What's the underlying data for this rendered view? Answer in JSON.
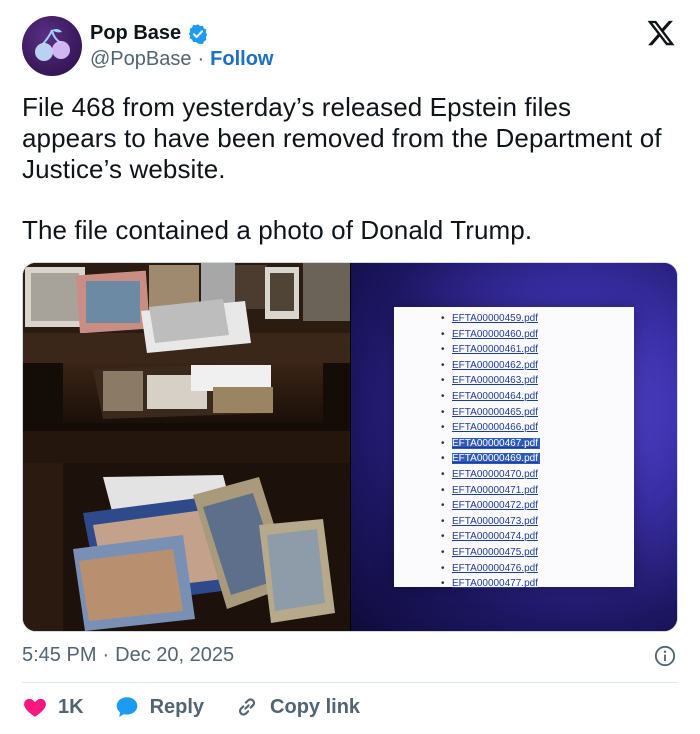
{
  "author": {
    "display_name": "Pop Base",
    "handle": "@PopBase",
    "separator": "·",
    "follow_label": "Follow"
  },
  "tweet": {
    "paragraph_1": "File 468 from yesterday’s released Epstein files appears to have been removed from the Department of Justice’s website.",
    "paragraph_2": "The file contained a photo of Donald Trump."
  },
  "media": {
    "left_image": "photo of framed pictures and papers in a desk drawer",
    "right_image": "screen photo of file list",
    "file_list": [
      "EFTA00000459.pdf",
      "EFTA00000460.pdf",
      "EFTA00000461.pdf",
      "EFTA00000462.pdf",
      "EFTA00000463.pdf",
      "EFTA00000464.pdf",
      "EFTA00000465.pdf",
      "EFTA00000466.pdf",
      "EFTA00000467.pdf",
      "EFTA00000469.pdf",
      "EFTA00000470.pdf",
      "EFTA00000471.pdf",
      "EFTA00000472.pdf",
      "EFTA00000473.pdf",
      "EFTA00000474.pdf",
      "EFTA00000475.pdf",
      "EFTA00000476.pdf",
      "EFTA00000477.pdf"
    ],
    "highlighted_files": [
      "EFTA00000467.pdf",
      "EFTA00000469.pdf"
    ]
  },
  "meta": {
    "time": "5:45 PM",
    "separator": "·",
    "date": "Dec 20, 2025"
  },
  "actions": {
    "like_count": "1K",
    "reply_label": "Reply",
    "copy_link_label": "Copy link"
  },
  "colors": {
    "accent": "#1d6fc4",
    "like": "#f91880",
    "reply": "#1d9bf0",
    "verified": "#1d9bf0",
    "muted": "#536471"
  },
  "icons": {
    "logo": "x-logo-icon",
    "verified": "verified-badge-icon",
    "info": "info-icon",
    "like": "heart-icon",
    "reply": "speech-bubble-icon",
    "copy_link": "link-icon"
  }
}
